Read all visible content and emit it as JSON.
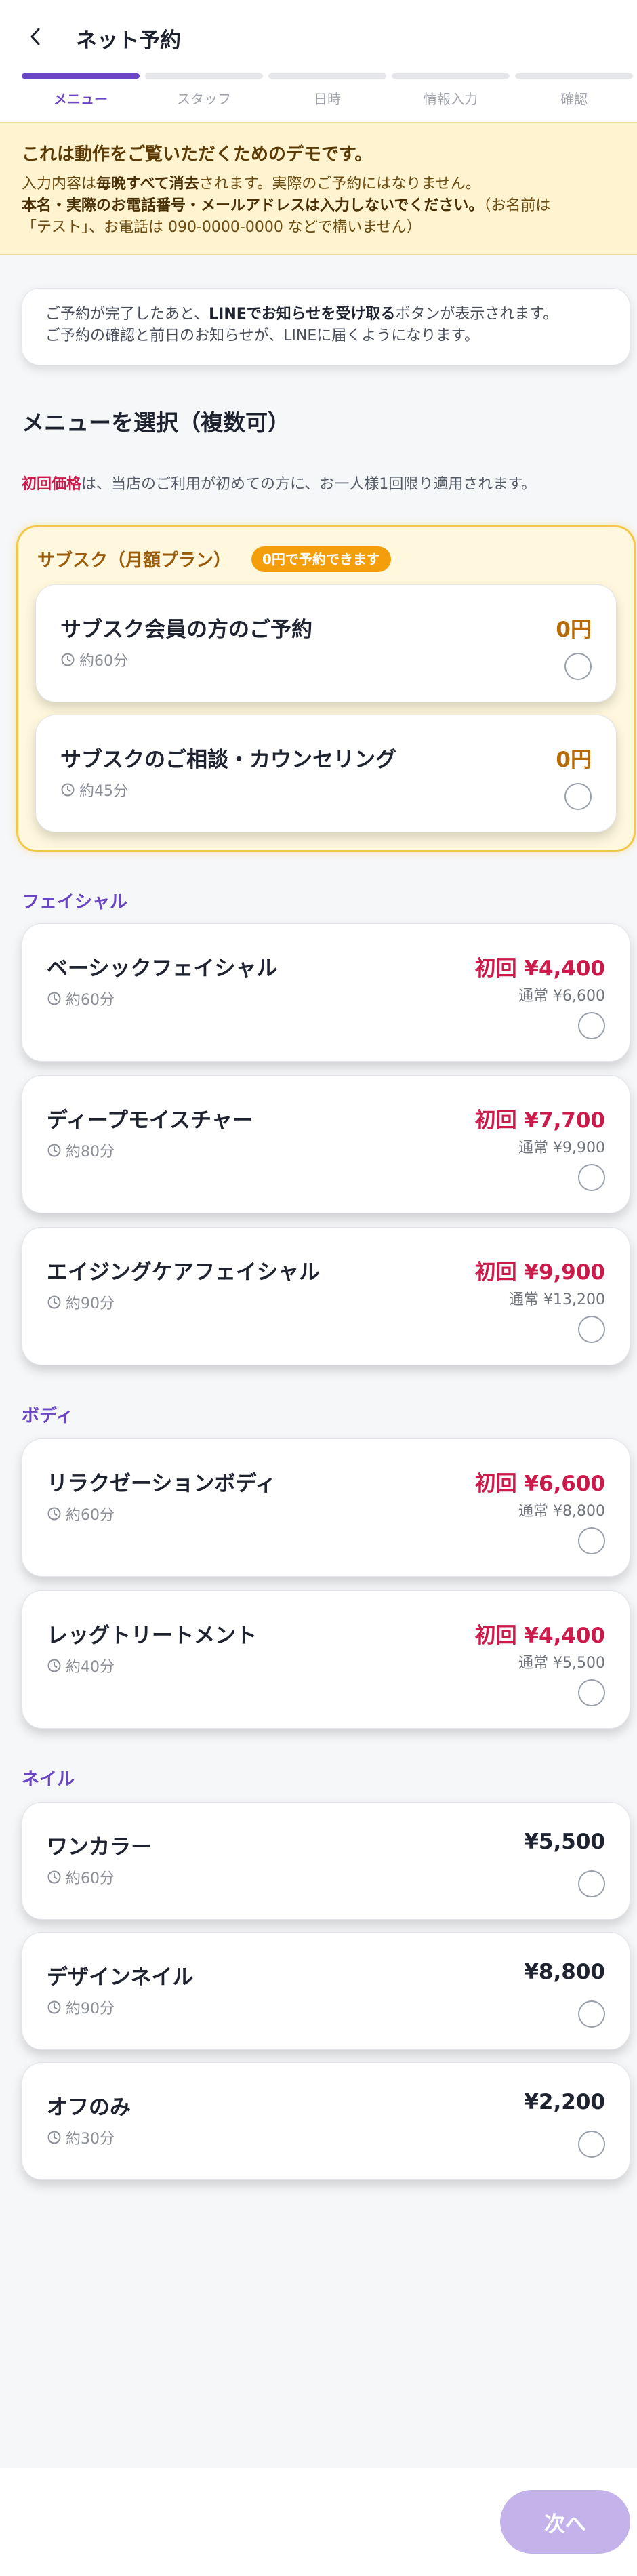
{
  "header": {
    "title": "ネット予約",
    "steps": [
      {
        "label": "メニュー",
        "active": true
      },
      {
        "label": "スタッフ",
        "active": false
      },
      {
        "label": "日時",
        "active": false
      },
      {
        "label": "情報入力",
        "active": false
      },
      {
        "label": "確認",
        "active": false
      }
    ]
  },
  "notice": {
    "heading": "これは動作をご覧いただくためのデモです。",
    "line1_a": "入力内容は",
    "line1_b": "毎晩すべて消去",
    "line1_c": "されます。実際のご予約にはなりません。",
    "line2_a": "本名・実際のお電話番号・メールアドレスは入力しないでください。",
    "line2_b": "（お名前は",
    "line3": "「テスト」、お電話は 090-0000-0000 などで構いません）"
  },
  "info": {
    "line1_a": "ご予約が完了したあと、",
    "line1_b": "LINEでお知らせを受け取る",
    "line1_c": "ボタンが表示されます。",
    "line2": "ご予約の確認と前日のお知らせが、LINEに届くようになります。"
  },
  "section": {
    "title": "メニューを選択（複数可）",
    "note_red": "初回価格",
    "note_rest": "は、当店のご利用が初めての方に、お一人様1回限り適用されます。"
  },
  "subscription": {
    "title": "サブスク（月額プラン）",
    "badge": "0円で予約できます",
    "items": [
      {
        "name": "サブスク会員の方のご予約",
        "duration": "約60分",
        "price": "0円"
      },
      {
        "name": "サブスクのご相談・カウンセリング",
        "duration": "約45分",
        "price": "0円"
      }
    ]
  },
  "facial": {
    "label": "フェイシャル",
    "items": [
      {
        "name": "ベーシックフェイシャル",
        "duration": "約60分",
        "price": "初回 ¥4,400",
        "normal": "通常 ¥6,600"
      },
      {
        "name": "ディープモイスチャー",
        "duration": "約80分",
        "price": "初回 ¥7,700",
        "normal": "通常 ¥9,900"
      },
      {
        "name": "エイジングケアフェイシャル",
        "duration": "約90分",
        "price": "初回 ¥9,900",
        "normal": "通常 ¥13,200"
      }
    ]
  },
  "body": {
    "label": "ボディ",
    "items": [
      {
        "name": "リラクゼーションボディ",
        "duration": "約60分",
        "price": "初回 ¥6,600",
        "normal": "通常 ¥8,800"
      },
      {
        "name": "レッグトリートメント",
        "duration": "約40分",
        "price": "初回 ¥4,400",
        "normal": "通常 ¥5,500"
      }
    ]
  },
  "nail": {
    "label": "ネイル",
    "items": [
      {
        "name": "ワンカラー",
        "duration": "約60分",
        "price": "¥5,500"
      },
      {
        "name": "デザインネイル",
        "duration": "約90分",
        "price": "¥8,800"
      },
      {
        "name": "オフのみ",
        "duration": "約30分",
        "price": "¥2,200"
      }
    ]
  },
  "footer": {
    "next_label": "次へ"
  },
  "colors": {
    "accent": "#6a46c4",
    "first_price": "#cc1a4a",
    "subscription_price": "#b86a06",
    "next_button": "#c4b3eb"
  }
}
